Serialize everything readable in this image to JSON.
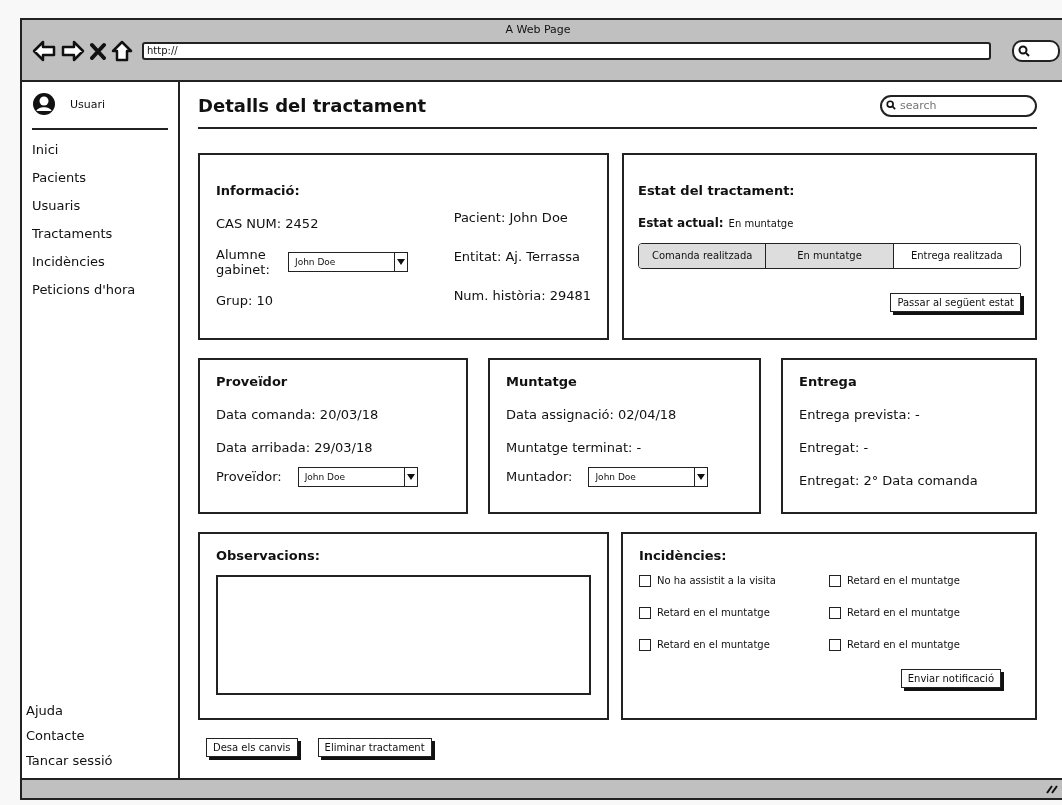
{
  "window": {
    "title": "A Web Page",
    "url": "http://"
  },
  "sidebar": {
    "user": "Usuari",
    "items": [
      {
        "label": "Inici"
      },
      {
        "label": "Pacients"
      },
      {
        "label": "Usuaris"
      },
      {
        "label": "Tractaments"
      },
      {
        "label": "Incidències"
      },
      {
        "label": "Peticions d'hora"
      }
    ],
    "footer_items": [
      {
        "label": "Ajuda"
      },
      {
        "label": "Contacte"
      },
      {
        "label": "Tancar sessió"
      }
    ]
  },
  "page": {
    "title": "Detalls del tractament",
    "search": {
      "placeholder": "search"
    }
  },
  "info": {
    "title": "Informació:",
    "left": [
      {
        "kind": "text",
        "text": "CAS NUM: 2452"
      },
      {
        "kind": "select",
        "label": "Alumne gabinet:",
        "value": "John Doe"
      },
      {
        "kind": "text",
        "text": "Grup: 10"
      }
    ],
    "right": [
      {
        "kind": "text",
        "text": "Pacient: John Doe"
      },
      {
        "kind": "text",
        "text": "Entitat: Aj. Terrassa"
      },
      {
        "kind": "text",
        "text": "Num. història: 29481"
      }
    ]
  },
  "status": {
    "title": "Estat del tractament:",
    "current_label": "Estat actual:",
    "current_value": "En muntatge",
    "steps": [
      {
        "label": "Comanda realitzada",
        "done": true
      },
      {
        "label": "En muntatge",
        "done": true
      },
      {
        "label": "Entrega realitzada",
        "done": false
      }
    ],
    "button": "Passar al següent estat"
  },
  "cards": [
    {
      "title": "Proveïdor",
      "lines": [
        {
          "kind": "text",
          "text": "Data comanda: 20/03/18"
        },
        {
          "kind": "text",
          "text": "Data arribada: 29/03/18"
        },
        {
          "kind": "select",
          "label": "Proveïdor:",
          "value": "John Doe"
        }
      ]
    },
    {
      "title": "Muntatge",
      "lines": [
        {
          "kind": "text",
          "text": "Data assignació: 02/04/18"
        },
        {
          "kind": "text",
          "text": "Muntatge terminat: -"
        },
        {
          "kind": "select",
          "label": "Muntador:",
          "value": "John Doe"
        }
      ]
    },
    {
      "title": "Entrega",
      "lines": [
        {
          "kind": "text",
          "text": "Entrega prevista: -"
        },
        {
          "kind": "text",
          "text": "Entregat: -"
        },
        {
          "kind": "text",
          "text": "Entregat: 2° Data comanda"
        }
      ]
    }
  ],
  "observations": {
    "title": "Observacions:"
  },
  "incidents": {
    "title": "Incidències:",
    "checks": [
      {
        "label": "No ha assistit a la visita",
        "checked": false
      },
      {
        "label": "Retard en el muntatge",
        "checked": false
      },
      {
        "label": "Retard en el muntatge",
        "checked": false
      },
      {
        "label": "Retard en el muntatge",
        "checked": false
      },
      {
        "label": "Retard en el muntatge",
        "checked": false
      },
      {
        "label": "Retard en el muntatge",
        "checked": false
      }
    ],
    "button": "Enviar notificació"
  },
  "buttons": [
    "Desa els canvis",
    "Eliminar tractament"
  ]
}
